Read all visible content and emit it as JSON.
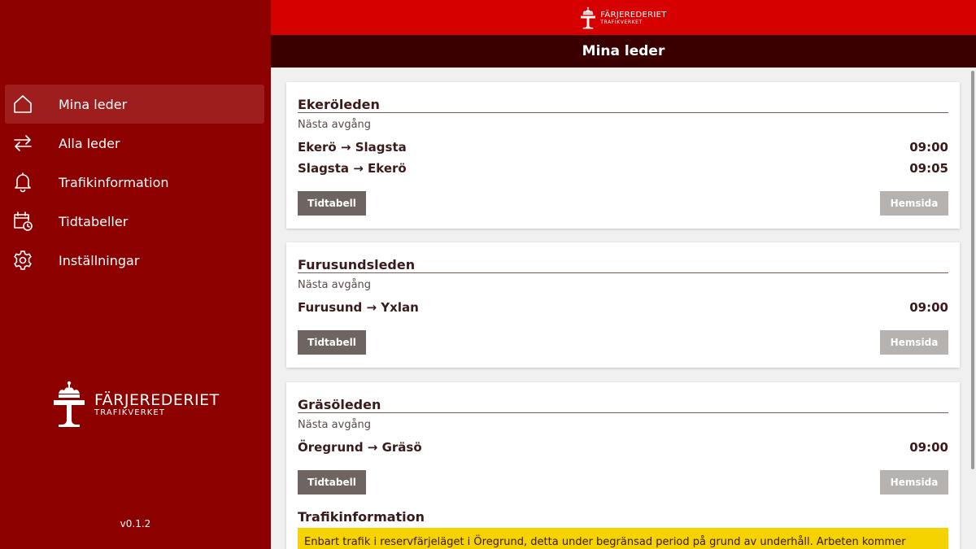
{
  "brand": {
    "name": "FÄRJEREDERIET",
    "sub": "TRAFIKVERKET"
  },
  "header": {
    "title": "Mina leder"
  },
  "sidebar": {
    "items": [
      {
        "label": "Mina leder",
        "icon": "home-icon",
        "active": true
      },
      {
        "label": "Alla leder",
        "icon": "arrows-swap-icon",
        "active": false
      },
      {
        "label": "Trafikinformation",
        "icon": "bell-icon",
        "active": false
      },
      {
        "label": "Tidtabeller",
        "icon": "calendar-clock-icon",
        "active": false
      },
      {
        "label": "Inställningar",
        "icon": "gear-icon",
        "active": false
      }
    ],
    "version": "v0.1.2"
  },
  "routes": [
    {
      "name": "Ekeröleden",
      "next_label": "Nästa avgång",
      "departures": [
        {
          "route": "Ekerö → Slagsta",
          "time": "09:00"
        },
        {
          "route": "Slagsta → Ekerö",
          "time": "09:05"
        }
      ],
      "timetable_label": "Tidtabell",
      "homepage_label": "Hemsida"
    },
    {
      "name": "Furusundsleden",
      "next_label": "Nästa avgång",
      "departures": [
        {
          "route": "Furusund → Yxlan",
          "time": "09:00"
        }
      ],
      "timetable_label": "Tidtabell",
      "homepage_label": "Hemsida"
    },
    {
      "name": "Gräsöleden",
      "next_label": "Nästa avgång",
      "departures": [
        {
          "route": "Öregrund → Gräsö",
          "time": "09:00"
        }
      ],
      "timetable_label": "Tidtabell",
      "homepage_label": "Hemsida",
      "traffic_title": "Trafikinformation",
      "traffic_text": "Enbart trafik i reservfärjeläget i Öregrund, detta under begränsad period på grund av underhåll. Arbeten kommer"
    }
  ],
  "colors": {
    "sidebar_bg": "#8c0000",
    "topbar_bg": "#d60000",
    "titlebar_bg": "#3a0000",
    "timetable_button": "#6e6560",
    "homepage_button": "#b5b2af",
    "traffic_notice": "#f5d300"
  }
}
